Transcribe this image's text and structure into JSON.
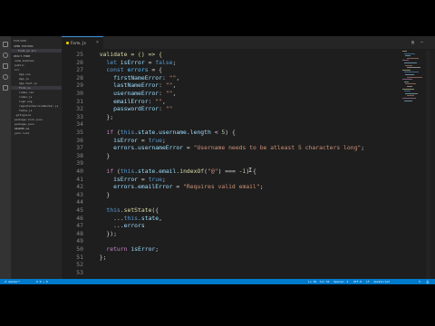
{
  "colors": {
    "activity_bar": "#333333",
    "sidebar": "#252526",
    "editor_bg": "#1e1e1e",
    "status_bar": "#007acc",
    "keyword": "#569cd6",
    "control": "#c586c0",
    "function": "#dcdcaa",
    "variable": "#9cdcfe",
    "string": "#ce9178",
    "number": "#b5cea8"
  },
  "activity_icons": [
    "files-icon",
    "search-icon",
    "source-control-icon",
    "debug-icon",
    "extensions-icon"
  ],
  "sidebar": {
    "header": "EXPLORER",
    "open_editors_label": "OPEN EDITORS",
    "open_file": "Form.js  src",
    "project_label": "REACT-FORM",
    "tree": [
      "node_modules",
      "public",
      "src",
      "App.css",
      "App.js",
      "App.test.js",
      "Form.js",
      "index.css",
      "index.js",
      "logo.svg",
      "registerServiceWorker.js",
      "Table.js",
      ".gitignore",
      "package-lock.json",
      "package.json",
      "README.md",
      "yarn.lock"
    ]
  },
  "tab": {
    "label": "Form.js"
  },
  "code": {
    "line_numbers": [
      "25",
      "26",
      "27",
      "28",
      "29",
      "30",
      "31",
      "32",
      "33",
      "34",
      "35",
      "36",
      "37",
      "38",
      "39",
      "40",
      "41",
      "42",
      "43",
      "44",
      "45",
      "46",
      "47",
      "48",
      "49",
      "50",
      "51",
      "52",
      "53"
    ],
    "lines": [
      [
        {
          "t": "  validate = () => {",
          "c": "tk-fn"
        }
      ],
      [
        {
          "t": "    let ",
          "c": "tk-kw"
        },
        {
          "t": "isError",
          "c": "tk-var"
        },
        {
          "t": " = ",
          "c": ""
        },
        {
          "t": "false",
          "c": "tk-kw"
        },
        {
          "t": ";",
          "c": ""
        }
      ],
      [
        {
          "t": "    const ",
          "c": "tk-kw"
        },
        {
          "t": "errors",
          "c": "tk-con"
        },
        {
          "t": " = {",
          "c": ""
        }
      ],
      [
        {
          "t": "      firstNameError",
          "c": "tk-var"
        },
        {
          "t": ": ",
          "c": ""
        },
        {
          "t": "\"\"",
          "c": "tk-str"
        },
        {
          "t": ",",
          "c": ""
        }
      ],
      [
        {
          "t": "      lastNameError",
          "c": "tk-var"
        },
        {
          "t": ": ",
          "c": ""
        },
        {
          "t": "\"\"",
          "c": "tk-str"
        },
        {
          "t": ",",
          "c": ""
        }
      ],
      [
        {
          "t": "      usernameError",
          "c": "tk-var"
        },
        {
          "t": ": ",
          "c": ""
        },
        {
          "t": "\"\"",
          "c": "tk-str"
        },
        {
          "t": ",",
          "c": ""
        }
      ],
      [
        {
          "t": "      emailError",
          "c": "tk-var"
        },
        {
          "t": ": ",
          "c": ""
        },
        {
          "t": "\"\"",
          "c": "tk-str"
        },
        {
          "t": ",",
          "c": ""
        }
      ],
      [
        {
          "t": "      passwordError",
          "c": "tk-var"
        },
        {
          "t": ": ",
          "c": ""
        },
        {
          "t": "\"\"",
          "c": "tk-str"
        }
      ],
      [
        {
          "t": "    };",
          "c": ""
        }
      ],
      [
        {
          "t": "",
          "c": ""
        }
      ],
      [
        {
          "t": "    if ",
          "c": "tk-ctl"
        },
        {
          "t": "(",
          "c": ""
        },
        {
          "t": "this",
          "c": "tk-kw"
        },
        {
          "t": ".state.username.length",
          "c": "tk-var"
        },
        {
          "t": " < ",
          "c": ""
        },
        {
          "t": "5",
          "c": "tk-num"
        },
        {
          "t": ") {",
          "c": ""
        }
      ],
      [
        {
          "t": "      isError",
          "c": "tk-var"
        },
        {
          "t": " = ",
          "c": ""
        },
        {
          "t": "true",
          "c": "tk-kw"
        },
        {
          "t": ";",
          "c": ""
        }
      ],
      [
        {
          "t": "      errors.usernameError",
          "c": "tk-var"
        },
        {
          "t": " = ",
          "c": ""
        },
        {
          "t": "\"Username needs to be atleast 5 characters long\"",
          "c": "tk-str"
        },
        {
          "t": ";",
          "c": ""
        }
      ],
      [
        {
          "t": "    }",
          "c": ""
        }
      ],
      [
        {
          "t": "",
          "c": ""
        }
      ],
      [
        {
          "t": "    if ",
          "c": "tk-ctl"
        },
        {
          "t": "(",
          "c": ""
        },
        {
          "t": "this",
          "c": "tk-kw"
        },
        {
          "t": ".state.email.",
          "c": "tk-var"
        },
        {
          "t": "indexOf",
          "c": "tk-fn"
        },
        {
          "t": "(",
          "c": ""
        },
        {
          "t": "\"@\"",
          "c": "tk-str"
        },
        {
          "t": ") === -",
          "c": ""
        },
        {
          "t": "1",
          "c": "tk-num"
        },
        {
          "t": ") {",
          "c": ""
        }
      ],
      [
        {
          "t": "      isError",
          "c": "tk-var"
        },
        {
          "t": " = ",
          "c": ""
        },
        {
          "t": "true",
          "c": "tk-kw"
        },
        {
          "t": ";",
          "c": ""
        }
      ],
      [
        {
          "t": "      errors.emailError",
          "c": "tk-var"
        },
        {
          "t": " = ",
          "c": ""
        },
        {
          "t": "\"Requires valid email\"",
          "c": "tk-str"
        },
        {
          "t": ";",
          "c": ""
        }
      ],
      [
        {
          "t": "    }",
          "c": ""
        }
      ],
      [
        {
          "t": "",
          "c": ""
        }
      ],
      [
        {
          "t": "    this",
          "c": "tk-kw"
        },
        {
          "t": ".",
          "c": ""
        },
        {
          "t": "setState",
          "c": "tk-fn"
        },
        {
          "t": "({",
          "c": ""
        }
      ],
      [
        {
          "t": "      ...",
          "c": ""
        },
        {
          "t": "this",
          "c": "tk-kw"
        },
        {
          "t": ".state",
          "c": "tk-var"
        },
        {
          "t": ",",
          "c": ""
        }
      ],
      [
        {
          "t": "      ...",
          "c": ""
        },
        {
          "t": "errors",
          "c": "tk-var"
        }
      ],
      [
        {
          "t": "    });",
          "c": ""
        }
      ],
      [
        {
          "t": "",
          "c": ""
        }
      ],
      [
        {
          "t": "    return ",
          "c": "tk-ctl"
        },
        {
          "t": "isError",
          "c": "tk-var"
        },
        {
          "t": ";",
          "c": ""
        }
      ],
      [
        {
          "t": "  };",
          "c": ""
        }
      ],
      [
        {
          "t": "",
          "c": ""
        }
      ],
      [
        {
          "t": "",
          "c": ""
        }
      ]
    ]
  },
  "status": {
    "left": "master*",
    "errors": "0",
    "warnings": "0",
    "position": "Ln 36, Col 52",
    "spaces": "Spaces: 2",
    "encoding": "UTF-8",
    "eol": "LF",
    "language": "JavaScript"
  }
}
